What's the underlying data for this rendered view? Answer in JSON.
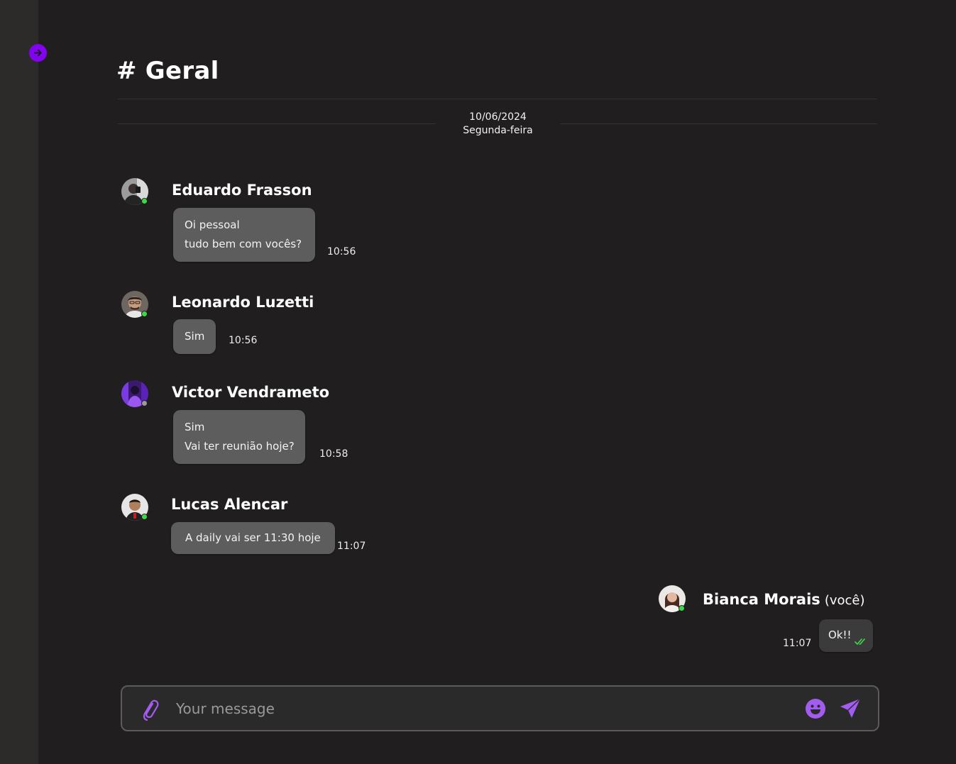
{
  "channel": {
    "hash": "#",
    "name": "Geral"
  },
  "date_separator": {
    "date": "10/06/2024",
    "weekday": "Segunda-feira"
  },
  "messages": [
    {
      "author": "Eduardo Frasson",
      "status": "online",
      "lines": [
        "Oi pessoal",
        "tudo bem com vocês?"
      ],
      "time": "10:56"
    },
    {
      "author": "Leonardo Luzetti",
      "status": "online",
      "lines": [
        "Sim"
      ],
      "time": "10:56"
    },
    {
      "author": "Victor Vendrameto",
      "status": "offline",
      "lines": [
        "Sim",
        "Vai ter reunião hoje?"
      ],
      "time": "10:58"
    },
    {
      "author": "Lucas Alencar",
      "status": "online",
      "lines": [
        "A daily vai ser 11:30 hoje"
      ],
      "time": "11:07"
    },
    {
      "author": "Bianca Morais",
      "you_tag": "(você)",
      "status": "online",
      "lines": [
        "Ok!!"
      ],
      "time": "11:07",
      "read": true
    }
  ],
  "composer": {
    "placeholder": "Your message",
    "value": ""
  },
  "colors": {
    "accent": "#8204ee",
    "icon_accent": "#a25cf0",
    "online": "#3dd84a",
    "read_check": "#3dd84a",
    "bubble": "#5d5d5d",
    "background": "#201e1f"
  },
  "icons": {
    "sidebar_toggle": "arrow-right-icon",
    "attach": "paperclip-icon",
    "emoji": "smiley-icon",
    "send": "send-icon",
    "read_receipt": "double-check-icon"
  }
}
